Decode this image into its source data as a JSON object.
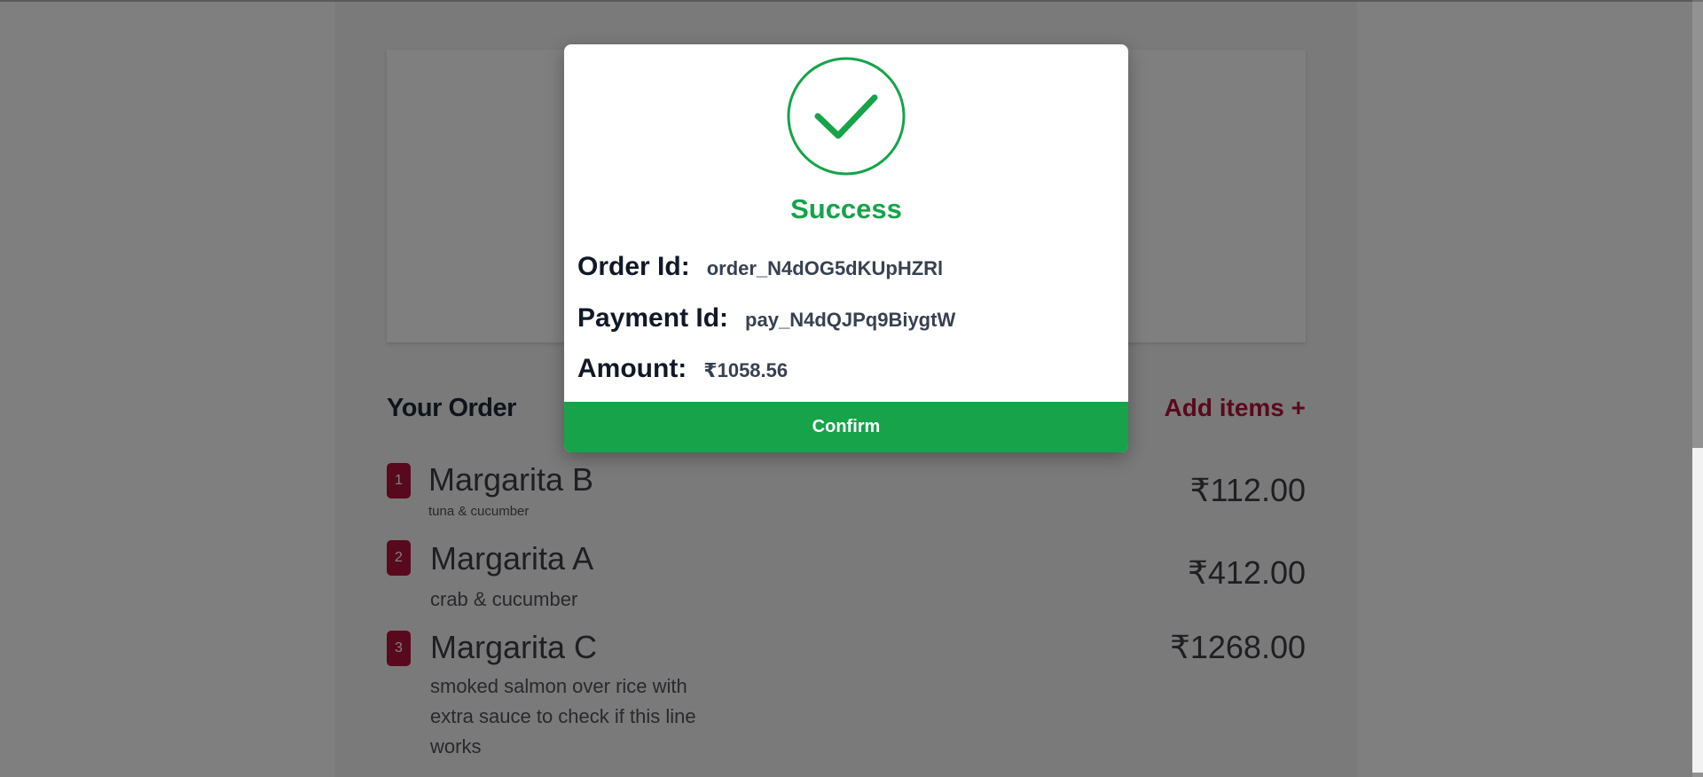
{
  "page": {
    "order_section": {
      "heading": "Your Order",
      "add_items_label": "Add items +",
      "items": [
        {
          "index": "1",
          "name": "Margarita B",
          "description": "tuna & cucumber",
          "price": "₹112.00"
        },
        {
          "index": "2",
          "name": "Margarita A",
          "description": "crab & cucumber",
          "price": "₹412.00"
        },
        {
          "index": "3",
          "name": "Margarita C",
          "description": "smoked salmon over rice with extra sauce to check if this line works",
          "price": "₹1268.00"
        }
      ]
    }
  },
  "modal": {
    "icon": "check-circle-icon",
    "title": "Success",
    "order_id_label": "Order Id:",
    "order_id_value": "order_N4dOG5dKUpHZRl",
    "payment_id_label": "Payment Id:",
    "payment_id_value": "pay_N4dQJPq9BiygtW",
    "amount_label": "Amount:",
    "amount_value": "₹1058.56",
    "confirm_label": "Confirm"
  },
  "colors": {
    "success": "#16a34a",
    "brand": "#b3123a",
    "overlay": "rgba(0,0,0,0.5)"
  }
}
